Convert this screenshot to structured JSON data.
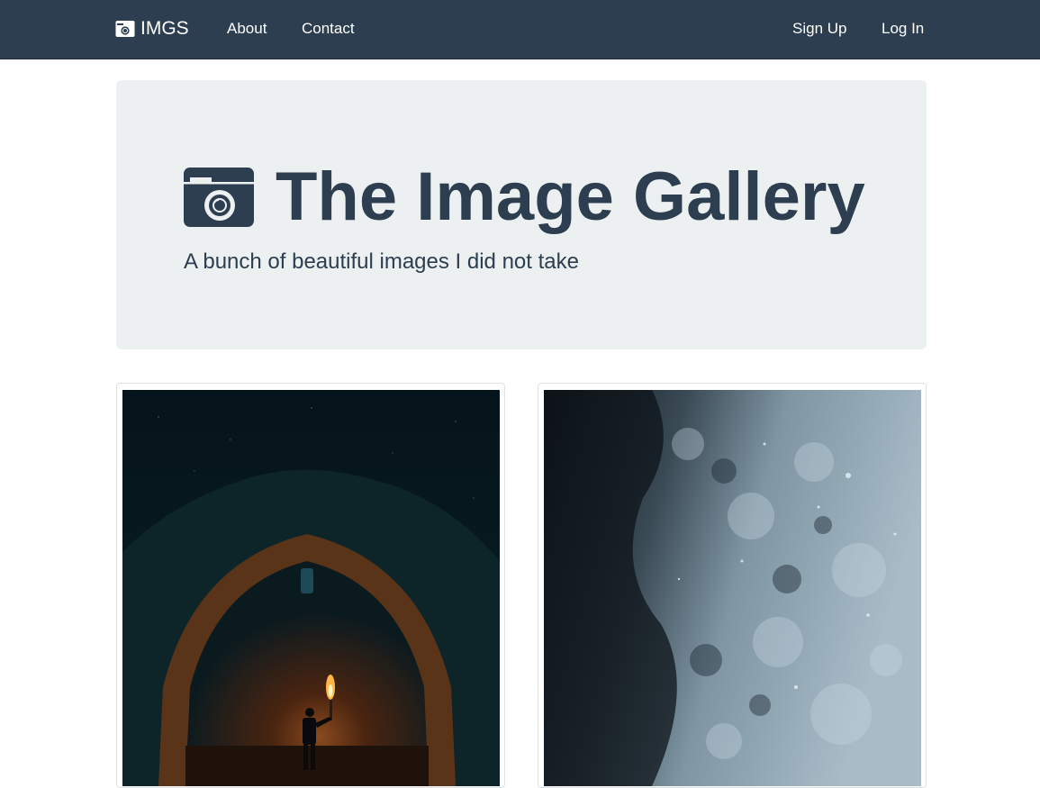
{
  "navbar": {
    "brand": "IMGS",
    "links": [
      "About",
      "Contact"
    ],
    "right_links": [
      "Sign Up",
      "Log In"
    ]
  },
  "hero": {
    "title": "The Image Gallery",
    "subtitle": "A bunch of beautiful images I did not take"
  },
  "colors": {
    "navbar_bg": "#2c3e50",
    "jumbotron_bg": "#ecf0f1",
    "text": "#2c3e50"
  },
  "icons": {
    "brand": "camera-icon",
    "hero": "camera-icon"
  }
}
